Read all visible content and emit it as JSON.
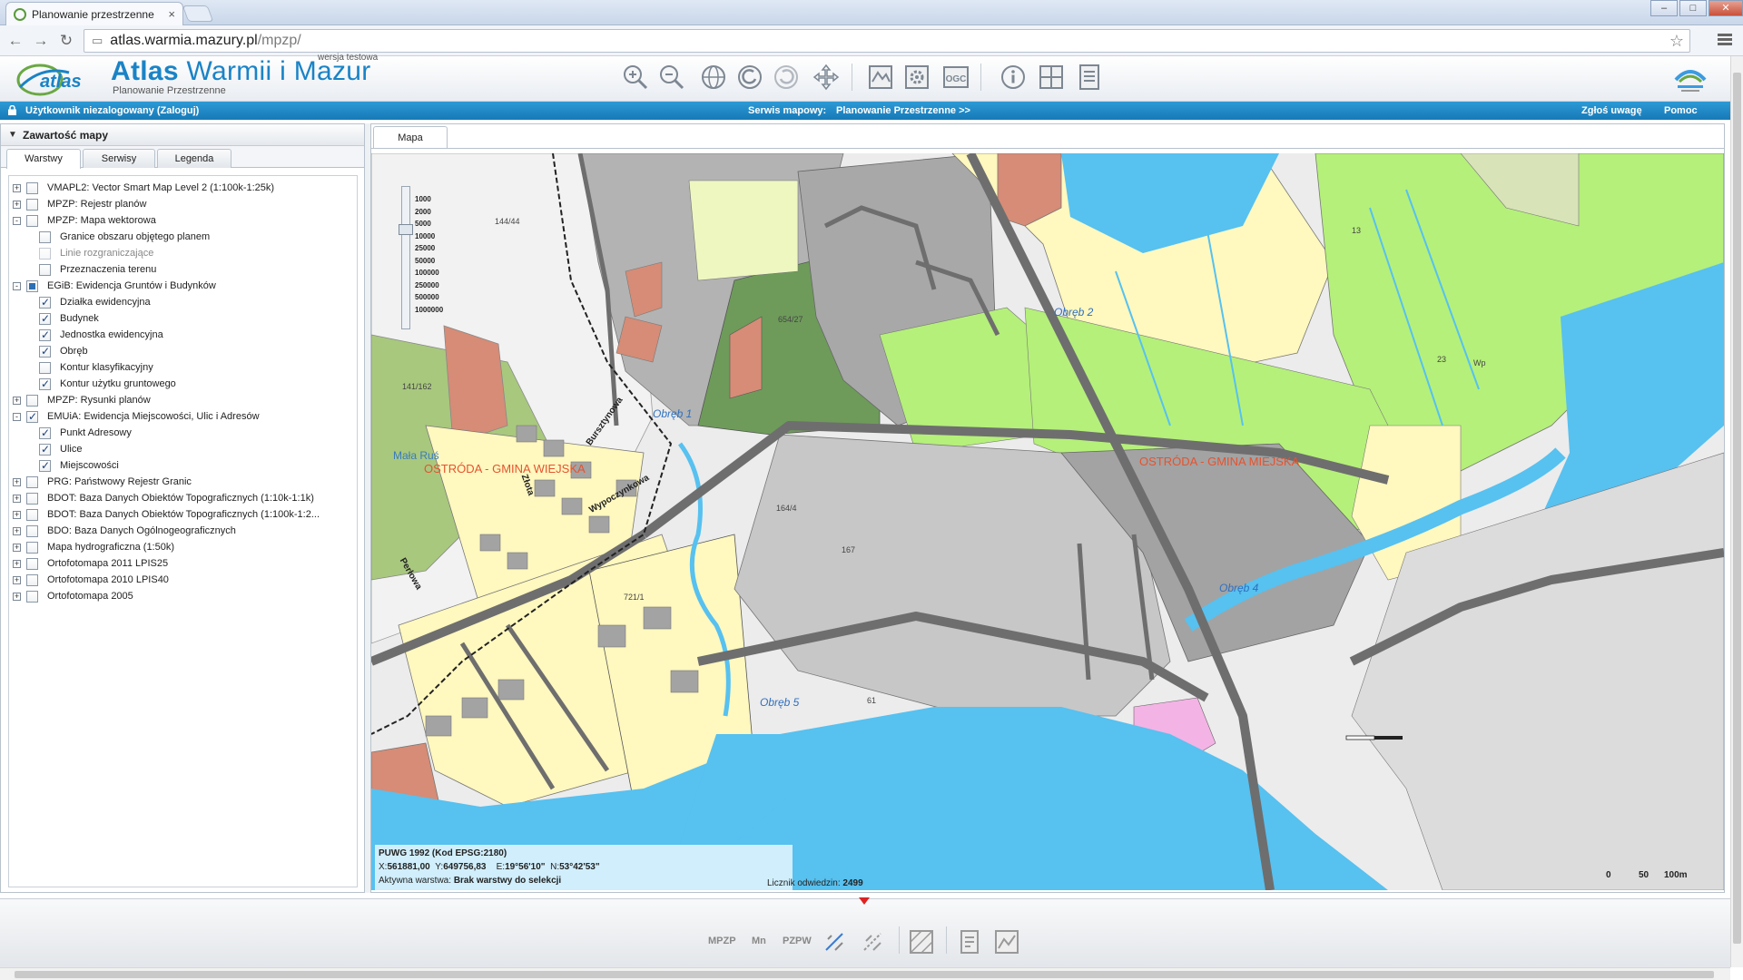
{
  "browser": {
    "tab_title": "Planowanie przestrzenne",
    "url_host": "atlas.warmia.mazury.pl",
    "url_path": "/mpzp/"
  },
  "header": {
    "logo_text": "atlas",
    "brand_title_bold": "Atlas",
    "brand_title_rest": " Warmii i Mazur",
    "brand_subtitle": "Planowanie Przestrzenne",
    "brand_badge": "wersja testowa",
    "toolbar_icons": [
      "zoom-in-icon",
      "zoom-out-icon",
      "globe-icon",
      "back-icon",
      "forward-icon",
      "pan-icon",
      "map-layers-icon",
      "settings-icon",
      "ogc-icon",
      "info-icon",
      "grid-icon",
      "document-list-icon"
    ],
    "ogc_label": "OGC"
  },
  "statusbar": {
    "user_text": "Użytkownik niezalogowany (Zaloguj)",
    "service_label": "Serwis mapowy:",
    "service_value": "Planowanie Przestrzenne >>",
    "report_link": "Zgłoś uwagę",
    "help_link": "Pomoc"
  },
  "leftpanel": {
    "title": "Zawartość mapy",
    "tabs": [
      "Warstwy",
      "Serwisy",
      "Legenda"
    ],
    "tree": [
      {
        "label": "VMAPL2: Vector Smart Map Level 2 (1:100k-1:25k)",
        "level": 0,
        "exp": "+",
        "cb": "off"
      },
      {
        "label": "MPZP: Rejestr planów",
        "level": 0,
        "exp": "+",
        "cb": "off"
      },
      {
        "label": "MPZP: Mapa wektorowa",
        "level": 0,
        "exp": "-",
        "cb": "off"
      },
      {
        "label": "Granice obszaru objętego planem",
        "level": 1,
        "cb": "off"
      },
      {
        "label": "Linie rozgraniczające",
        "level": 1,
        "cb": "dis"
      },
      {
        "label": "Przeznaczenia terenu",
        "level": 1,
        "cb": "off"
      },
      {
        "label": "EGiB: Ewidencja Gruntów i Budynków",
        "level": 0,
        "exp": "-",
        "cb": "part"
      },
      {
        "label": "Działka ewidencyjna",
        "level": 1,
        "cb": "on"
      },
      {
        "label": "Budynek",
        "level": 1,
        "cb": "on"
      },
      {
        "label": "Jednostka ewidencyjna",
        "level": 1,
        "cb": "on"
      },
      {
        "label": "Obręb",
        "level": 1,
        "cb": "on"
      },
      {
        "label": "Kontur klasyfikacyjny",
        "level": 1,
        "cb": "off"
      },
      {
        "label": "Kontur użytku gruntowego",
        "level": 1,
        "cb": "on"
      },
      {
        "label": "MPZP: Rysunki planów",
        "level": 0,
        "exp": "+",
        "cb": "off"
      },
      {
        "label": "EMUiA: Ewidencja Miejscowości, Ulic i Adresów",
        "level": 0,
        "exp": "-",
        "cb": "on"
      },
      {
        "label": "Punkt Adresowy",
        "level": 1,
        "cb": "on"
      },
      {
        "label": "Ulice",
        "level": 1,
        "cb": "on"
      },
      {
        "label": "Miejscowości",
        "level": 1,
        "cb": "on"
      },
      {
        "label": "PRG: Państwowy Rejestr Granic",
        "level": 0,
        "exp": "+",
        "cb": "off"
      },
      {
        "label": "BDOT: Baza Danych Obiektów Topograficznych (1:10k-1:1k)",
        "level": 0,
        "exp": "+",
        "cb": "off"
      },
      {
        "label": "BDOT: Baza Danych Obiektów Topograficznych (1:100k-1:2...",
        "level": 0,
        "exp": "+",
        "cb": "off"
      },
      {
        "label": "BDO: Baza Danych Ogólnogeograficznych",
        "level": 0,
        "exp": "+",
        "cb": "off"
      },
      {
        "label": "Mapa hydrograficzna (1:50k)",
        "level": 0,
        "exp": "+",
        "cb": "off"
      },
      {
        "label": "Ortofotomapa 2011 LPIS25",
        "level": 0,
        "exp": "+",
        "cb": "off"
      },
      {
        "label": "Ortofotomapa 2010 LPIS40",
        "level": 0,
        "exp": "+",
        "cb": "off"
      },
      {
        "label": "Ortofotomapa 2005",
        "level": 0,
        "exp": "+",
        "cb": "off"
      }
    ]
  },
  "map": {
    "tab_label": "Mapa",
    "zoom_scales": [
      "1000",
      "2000",
      "5000",
      "10000",
      "25000",
      "50000",
      "100000",
      "250000",
      "500000",
      "1000000"
    ],
    "labels": {
      "gmina_left": "OSTRÓDA - GMINA WIEJSKA",
      "gmina_right": "OSTRÓDA - GMINA MIEJSKA",
      "obreb1": "Obręb 1",
      "obreb2": "Obręb 2",
      "obreb4": "Obręb 4",
      "obreb5": "Obręb 5",
      "mala_rus": "Mała Ruś",
      "street_burszt": "Bursztynowa",
      "street_zlota": "Złota",
      "street_wypoczynkowa": "Wypoczynkowa",
      "street_perlowa": "Perłowa",
      "parcel_144_44": "144/44",
      "parcel_654_27": "654/27",
      "parcel_164_4": "164/4",
      "parcel_167": "167",
      "parcel_61": "61",
      "parcel_23": "23",
      "parcel_721_1": "721/1",
      "parcel_141_162": "141/162",
      "parcel_13": "13",
      "parcel_wp": "Wp"
    },
    "info": {
      "crs": "PUWG 1992 (Kod EPSG:2180)",
      "x_label": "X:",
      "x_value": "561881,00",
      "y_label": "Y:",
      "y_value": "649756,83",
      "e_label": "E:",
      "e_value": "19°56'10\"",
      "n_label": "N:",
      "n_value": "53°42'53\"",
      "active_layer_label": "Aktywna warstwa:",
      "active_layer_value": "Brak warstwy do selekcji",
      "counter_label": "Licznik odwiedzin:",
      "counter_value": "2499"
    },
    "scale": {
      "a": "0",
      "b": "50",
      "c": "100m"
    }
  },
  "bottomtools": [
    "MPZP",
    "Mn",
    "PZPW"
  ],
  "colors": {
    "accent_blue": "#1a83c6",
    "water": "#57c1f0",
    "residential": "#fff8bf",
    "meadow": "#b5f07a",
    "forest": "#8fbf72",
    "buildings": "#a3a3a3",
    "roads": "#6e6e6e",
    "brown": "#d68c76"
  }
}
